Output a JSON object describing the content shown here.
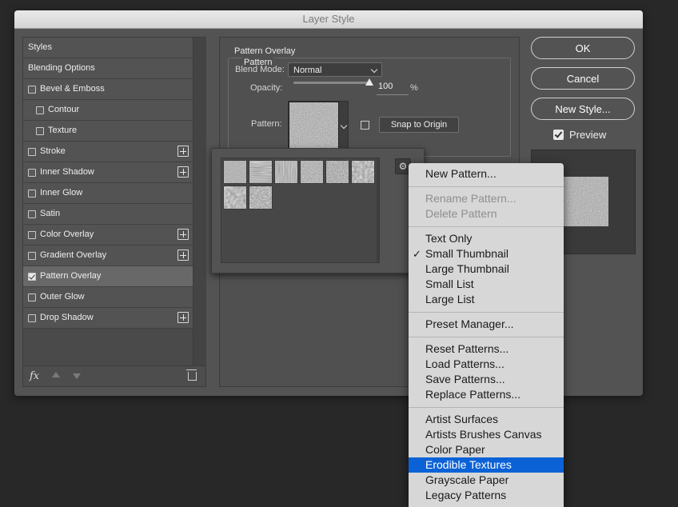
{
  "dialog": {
    "title": "Layer Style"
  },
  "sidebar": {
    "items": [
      {
        "label": "Styles",
        "checkbox": false,
        "checked": false,
        "plus": false,
        "indent": 0,
        "selected": false
      },
      {
        "label": "Blending Options",
        "checkbox": false,
        "checked": false,
        "plus": false,
        "indent": 0,
        "selected": false
      },
      {
        "label": "Bevel & Emboss",
        "checkbox": true,
        "checked": false,
        "plus": false,
        "indent": 0,
        "selected": false
      },
      {
        "label": "Contour",
        "checkbox": true,
        "checked": false,
        "plus": false,
        "indent": 1,
        "selected": false
      },
      {
        "label": "Texture",
        "checkbox": true,
        "checked": false,
        "plus": false,
        "indent": 1,
        "selected": false
      },
      {
        "label": "Stroke",
        "checkbox": true,
        "checked": false,
        "plus": true,
        "indent": 0,
        "selected": false
      },
      {
        "label": "Inner Shadow",
        "checkbox": true,
        "checked": false,
        "plus": true,
        "indent": 0,
        "selected": false
      },
      {
        "label": "Inner Glow",
        "checkbox": true,
        "checked": false,
        "plus": false,
        "indent": 0,
        "selected": false
      },
      {
        "label": "Satin",
        "checkbox": true,
        "checked": false,
        "plus": false,
        "indent": 0,
        "selected": false
      },
      {
        "label": "Color Overlay",
        "checkbox": true,
        "checked": false,
        "plus": true,
        "indent": 0,
        "selected": false
      },
      {
        "label": "Gradient Overlay",
        "checkbox": true,
        "checked": false,
        "plus": true,
        "indent": 0,
        "selected": false
      },
      {
        "label": "Pattern Overlay",
        "checkbox": true,
        "checked": true,
        "plus": false,
        "indent": 0,
        "selected": true
      },
      {
        "label": "Outer Glow",
        "checkbox": true,
        "checked": false,
        "plus": false,
        "indent": 0,
        "selected": false
      },
      {
        "label": "Drop Shadow",
        "checkbox": true,
        "checked": false,
        "plus": true,
        "indent": 0,
        "selected": false
      }
    ],
    "footer": {
      "fx_label": "fx"
    }
  },
  "panel": {
    "section_title": "Pattern Overlay",
    "group_title": "Pattern",
    "blend_mode_label": "Blend Mode:",
    "blend_mode_value": "Normal",
    "opacity_label": "Opacity:",
    "opacity_value": "100",
    "opacity_percent": 100,
    "opacity_unit": "%",
    "pattern_label": "Pattern:",
    "snap_button": "Snap to Origin"
  },
  "buttons": {
    "ok": "OK",
    "cancel": "Cancel",
    "new_style": "New Style...",
    "preview_label": "Preview",
    "preview_checked": true
  },
  "picker": {
    "thumbnails": [
      {
        "texture": "granite",
        "selected": false
      },
      {
        "texture": "stripes-h",
        "selected": false
      },
      {
        "texture": "stripes-v",
        "selected": false
      },
      {
        "texture": "canvas",
        "selected": false
      },
      {
        "texture": "rough",
        "selected": false
      },
      {
        "texture": "paper",
        "selected": false
      },
      {
        "texture": "grain",
        "selected": false
      },
      {
        "texture": "noise",
        "selected": false
      }
    ],
    "gear_icon": "gear-icon"
  },
  "menu": {
    "groups": [
      [
        {
          "label": "New Pattern...",
          "disabled": false
        }
      ],
      [
        {
          "label": "Rename Pattern...",
          "disabled": true
        },
        {
          "label": "Delete Pattern",
          "disabled": true
        }
      ],
      [
        {
          "label": "Text Only",
          "disabled": false
        },
        {
          "label": "Small Thumbnail",
          "disabled": false,
          "checked": true
        },
        {
          "label": "Large Thumbnail",
          "disabled": false
        },
        {
          "label": "Small List",
          "disabled": false
        },
        {
          "label": "Large List",
          "disabled": false
        }
      ],
      [
        {
          "label": "Preset Manager...",
          "disabled": false
        }
      ],
      [
        {
          "label": "Reset Patterns...",
          "disabled": false
        },
        {
          "label": "Load Patterns...",
          "disabled": false
        },
        {
          "label": "Save Patterns...",
          "disabled": false
        },
        {
          "label": "Replace Patterns...",
          "disabled": false
        }
      ],
      [
        {
          "label": "Artist Surfaces",
          "disabled": false
        },
        {
          "label": "Artists Brushes Canvas",
          "disabled": false
        },
        {
          "label": "Color Paper",
          "disabled": false
        },
        {
          "label": "Erodible Textures",
          "disabled": false,
          "highlighted": true
        },
        {
          "label": "Grayscale Paper",
          "disabled": false
        },
        {
          "label": "Legacy Patterns",
          "disabled": false
        }
      ]
    ],
    "check_glyph": "✓"
  },
  "colors": {
    "highlight": "#0b62d6",
    "dialog_bg": "#535353",
    "selected_item": "#686868"
  }
}
